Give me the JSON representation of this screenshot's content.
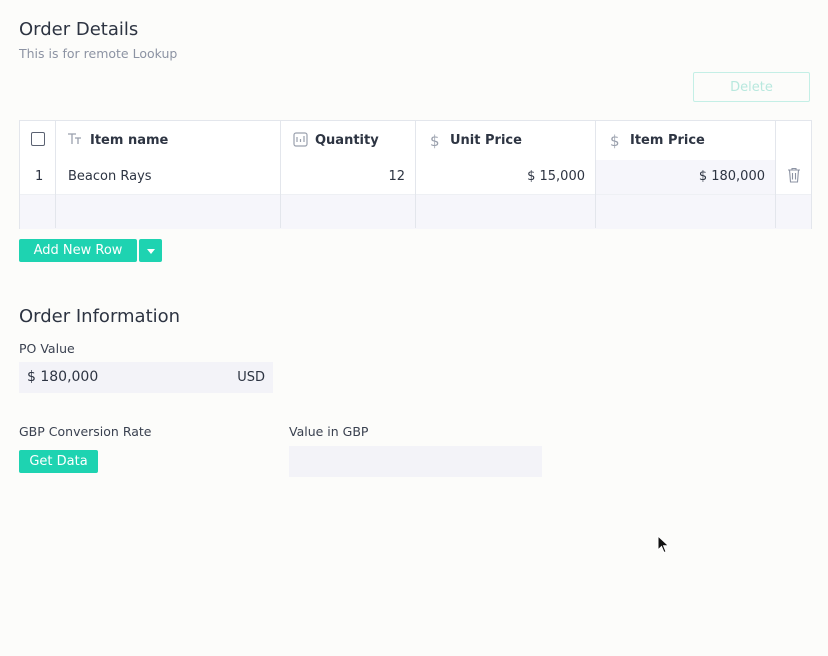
{
  "order_details": {
    "title": "Order Details",
    "subtitle": "This is for remote Lookup",
    "delete_label": "Delete",
    "columns": {
      "item_name": "Item name",
      "quantity": "Quantity",
      "unit_price": "Unit Price",
      "item_price": "Item Price"
    },
    "rows": [
      {
        "index": "1",
        "item_name": "Beacon Rays",
        "quantity": "12",
        "unit_price": "$ 15,000",
        "item_price": "$ 180,000"
      }
    ],
    "add_row_label": "Add New Row",
    "icons": [
      "text-type-icon",
      "number-icon",
      "dollar-icon",
      "trash-icon",
      "caret-down-icon"
    ]
  },
  "order_information": {
    "title": "Order Information",
    "po_value": {
      "label": "PO Value",
      "value": "$ 180,000",
      "currency": "USD"
    },
    "gbp_rate": {
      "label": "GBP Conversion Rate",
      "button_label": "Get Data"
    },
    "value_in_gbp": {
      "label": "Value in GBP",
      "value": ""
    }
  },
  "colors": {
    "accent": "#1ed3b1",
    "text": "#2d3442",
    "muted": "#8c93a3"
  }
}
